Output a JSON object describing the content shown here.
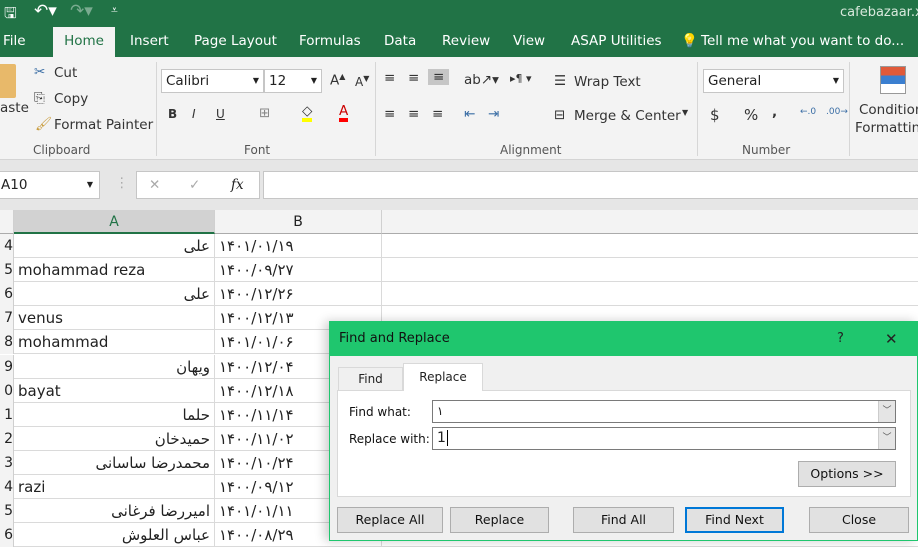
{
  "window": {
    "filename": "cafebazaar.xl"
  },
  "tabs": [
    "File",
    "Home",
    "Insert",
    "Page Layout",
    "Formulas",
    "Data",
    "Review",
    "View",
    "ASAP Utilities"
  ],
  "tell_me": "Tell me what you want to do...",
  "clipboard": {
    "paste": "aste",
    "cut": "Cut",
    "copy": "Copy",
    "format_painter": "Format Painter",
    "group": "Clipboard"
  },
  "font": {
    "name": "Calibri",
    "size": "12",
    "bold": "B",
    "italic": "I",
    "underline": "U",
    "font_color": "A",
    "group": "Font"
  },
  "alignment": {
    "wrap": "Wrap Text",
    "merge": "Merge & Center",
    "group": "Alignment"
  },
  "number": {
    "format": "General",
    "currency": "$",
    "percent": "%",
    "comma": ",",
    "group": "Number"
  },
  "styles": {
    "conditional1": "Condition",
    "conditional2": "Formatting"
  },
  "formula_bar": {
    "name_box": "A10",
    "fx": "fx",
    "value": ""
  },
  "columns": [
    "A",
    "B"
  ],
  "rows": [
    {
      "n": "4",
      "a": "علی",
      "rtl": true,
      "b": "۱۴۰۱/۰۱/۱۹"
    },
    {
      "n": "5",
      "a": "mohammad reza",
      "rtl": false,
      "b": "۱۴۰۰/۰۹/۲۷"
    },
    {
      "n": "6",
      "a": "علی",
      "rtl": true,
      "b": "۱۴۰۰/۱۲/۲۶"
    },
    {
      "n": "7",
      "a": "venus",
      "rtl": false,
      "b": "۱۴۰۰/۱۲/۱۳"
    },
    {
      "n": "8",
      "a": "mohammad",
      "rtl": false,
      "b": "۱۴۰۱/۰۱/۰۶"
    },
    {
      "n": "9",
      "a": "ویهان",
      "rtl": true,
      "b": "۱۴۰۰/۱۲/۰۴"
    },
    {
      "n": "0",
      "a": "bayat",
      "rtl": false,
      "b": "۱۴۰۰/۱۲/۱۸"
    },
    {
      "n": "1",
      "a": "حلما",
      "rtl": true,
      "b": "۱۴۰۰/۱۱/۱۴"
    },
    {
      "n": "2",
      "a": "حمیدخان",
      "rtl": true,
      "b": "۱۴۰۰/۱۱/۰۲"
    },
    {
      "n": "3",
      "a": "محمدرضا ساسانی",
      "rtl": true,
      "b": "۱۴۰۰/۱۰/۲۴"
    },
    {
      "n": "4",
      "a": "razi",
      "rtl": false,
      "b": "۱۴۰۰/۰۹/۱۲"
    },
    {
      "n": "5",
      "a": "امیررضا فرغانی",
      "rtl": true,
      "b": "۱۴۰۱/۰۱/۱۱"
    },
    {
      "n": "6",
      "a": "عباس العلوش",
      "rtl": true,
      "b": "۱۴۰۰/۰۸/۲۹"
    }
  ],
  "dialog": {
    "title": "Find and Replace",
    "help": "?",
    "close_x": "✕",
    "tab_find": "Find",
    "tab_replace": "Replace",
    "find_label": "Find what:",
    "find_value": "۱",
    "replace_label": "Replace with:",
    "replace_value": "1",
    "options": "Options >>",
    "buttons": [
      "Replace All",
      "Replace",
      "Find All",
      "Find Next",
      "Close"
    ]
  },
  "colors": {
    "excel_green": "#217346",
    "dialog_title": "#1fc66e",
    "fill_yellow": "#ffff00",
    "font_red": "#ff0000"
  }
}
